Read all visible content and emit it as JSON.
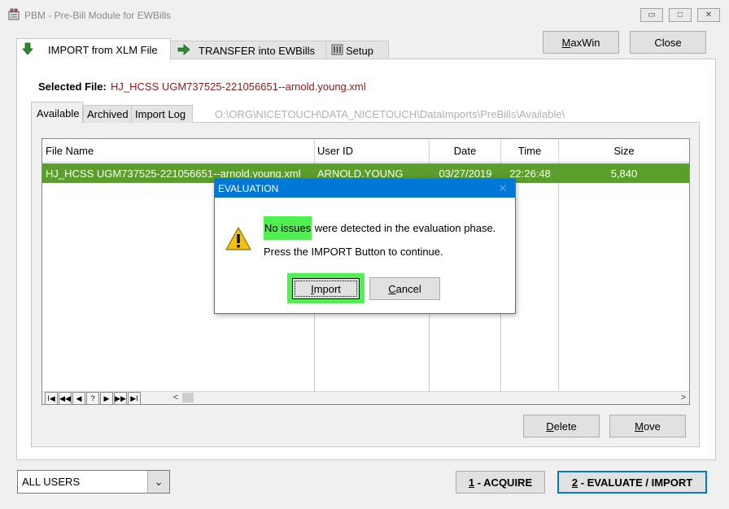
{
  "window": {
    "title": "PBM - Pre-Bill Module for EWBills",
    "controls": {
      "minimize": "▭",
      "maximize": "□",
      "close": "✕"
    }
  },
  "top_buttons": {
    "maxwin_mn": "M",
    "maxwin_rest": "axWin",
    "close": "Close"
  },
  "main_tabs": [
    {
      "label": "IMPORT from XLM File",
      "icon": "download-arrow-icon",
      "active": true
    },
    {
      "label": "TRANSFER into EWBills",
      "icon": "transfer-arrow-icon",
      "active": false
    },
    {
      "label": "Setup",
      "icon": "setup-icon",
      "active": false
    }
  ],
  "selected_file": {
    "label": "Selected File:",
    "value": "HJ_HCSS UGM737525-221056651--arnold.young.xml"
  },
  "sub_tabs": [
    {
      "label": "Available",
      "active": true
    },
    {
      "label": "Archived",
      "active": false
    },
    {
      "label": "Import Log",
      "active": false
    }
  ],
  "path": "O:\\ORG\\NICETOUCH\\DATA_NICETOUCH\\DataImports\\PreBills\\Available\\",
  "table": {
    "columns": [
      "File Name",
      "User ID",
      "Date",
      "Time",
      "Size"
    ],
    "rows": [
      {
        "file_name": "HJ_HCSS UGM737525-221056651--arnold.young.xml",
        "user_id": "ARNOLD.YOUNG",
        "date": "03/27/2019",
        "time": "22:26:48",
        "size": "5,840"
      }
    ],
    "nav": [
      "I◀",
      "◀◀",
      "◀",
      "?",
      "▶",
      "▶▶",
      "▶I"
    ],
    "scroll_left": "<",
    "scroll_right": ">"
  },
  "file_buttons": {
    "delete_mn": "D",
    "delete_rest": "elete",
    "move_mn": "M",
    "move_rest": "ove"
  },
  "users_select": {
    "value": "ALL USERS",
    "arrow": "⌄"
  },
  "action_buttons": {
    "acquire_mn": "1",
    "acquire_rest": " - ACQUIRE",
    "evaluate_mn": "2",
    "evaluate_rest": " - EVALUATE / IMPORT"
  },
  "dialog": {
    "title": "EVALUATION",
    "close": "✕",
    "highlight": "No issues",
    "message_rest": " were detected in the evaluation phase.",
    "message2": "Press the IMPORT Button to continue.",
    "import_mn": "I",
    "import_rest": "mport",
    "cancel_mn": "C",
    "cancel_rest": "ancel"
  },
  "colors": {
    "row_selected": "#5a9e2c",
    "highlight_green": "#4ff04f",
    "dialog_title_bar": "#0078d7",
    "file_value": "#8b1a1a"
  }
}
